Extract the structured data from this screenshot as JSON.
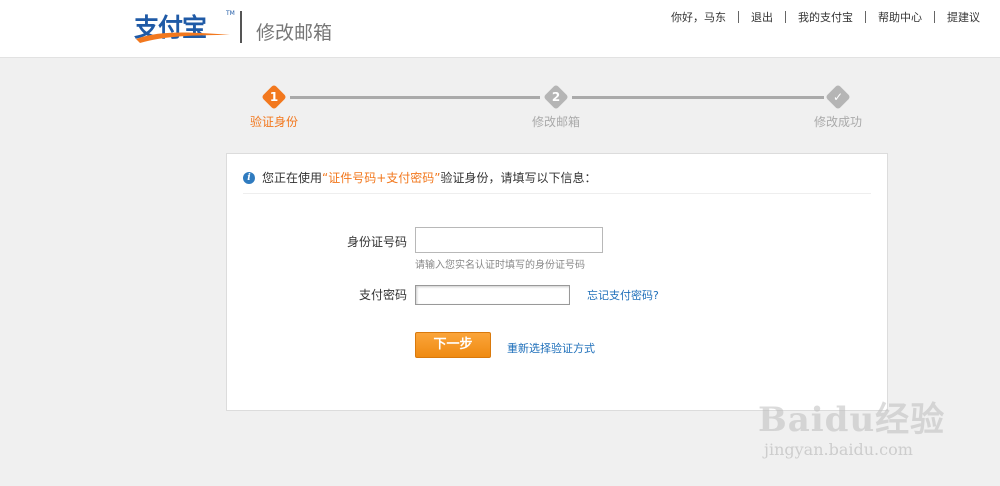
{
  "header": {
    "logo_text": "支付宝",
    "logo_tm": "TM",
    "page_heading": "修改邮箱",
    "nav": {
      "greeting": "你好，马东",
      "logout": "退出",
      "my_alipay": "我的支付宝",
      "help": "帮助中心",
      "feedback": "提建议"
    }
  },
  "steps": {
    "step1": {
      "num": "1",
      "label": "验证身份",
      "state": "active"
    },
    "step2": {
      "num": "2",
      "label": "修改邮箱",
      "state": "todo"
    },
    "step3": {
      "num": "✓",
      "label": "修改成功",
      "state": "todo"
    }
  },
  "notice": {
    "prefix": "您正在使用",
    "highlight": "“证件号码+支付密码”",
    "suffix": "验证身份，请填写以下信息："
  },
  "form": {
    "id_label": "身份证号码",
    "id_value": "",
    "id_hint": "请输入您实名认证时填写的身份证号码",
    "pw_label": "支付密码",
    "pw_value": "",
    "forgot_link": "忘记支付密码?",
    "next_button": "下一步",
    "reselect_link": "重新选择验证方式"
  },
  "watermark": {
    "big": "Baidu经验",
    "small": "jingyan.baidu.com"
  },
  "colors": {
    "accent": "#f2781e",
    "link": "#1e6fba",
    "brand": "#1f5aa6"
  }
}
